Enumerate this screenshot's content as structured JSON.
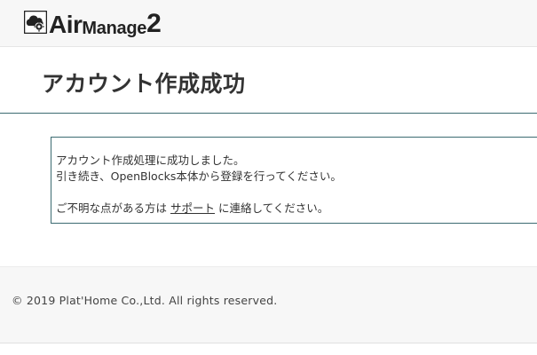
{
  "header": {
    "logo": {
      "text_air": "Air",
      "text_manage": "Manage",
      "text_num": "2",
      "icon": "cloud-gear-icon"
    }
  },
  "page": {
    "title": "アカウント作成成功"
  },
  "message": {
    "line1": "アカウント作成処理に成功しました。",
    "line2": "引き続き、OpenBlocks本体から登録を行ってください。",
    "line3_before": "ご不明な点がある方は ",
    "support_link": "サポート",
    "line3_after": " に連絡してください。"
  },
  "footer": {
    "copyright": "© 2019 Plat'Home Co.,Ltd. All rights reserved."
  },
  "colors": {
    "header_bg": "#f7f7f7",
    "accent_border": "#3c6b72",
    "text": "#333333"
  }
}
